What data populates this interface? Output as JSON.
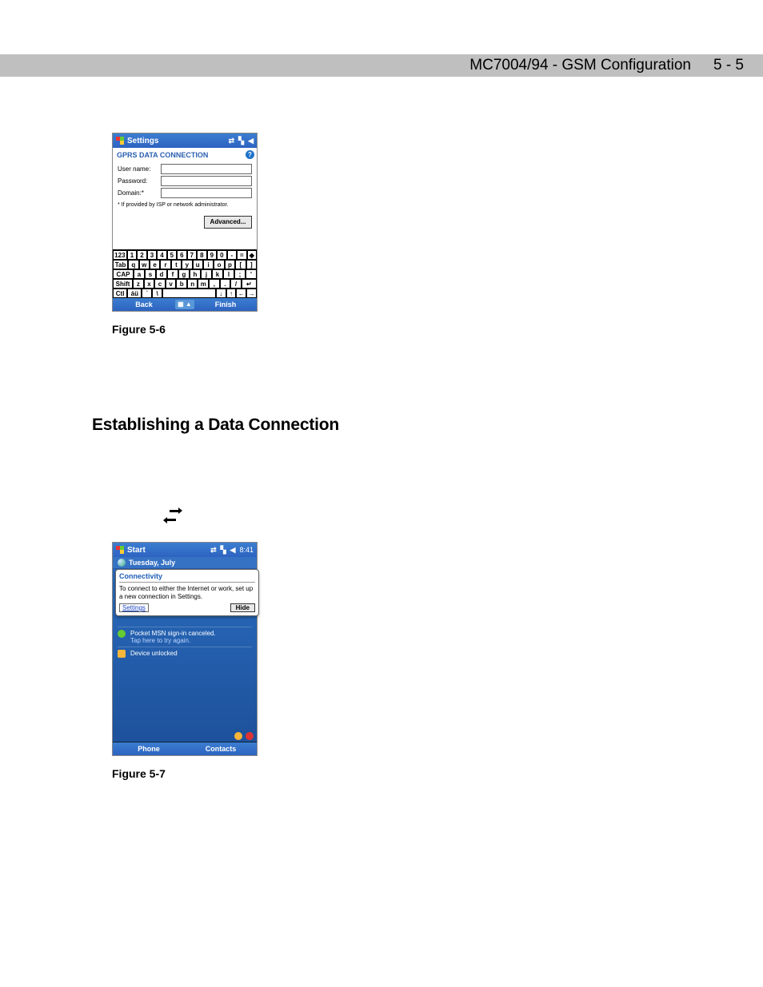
{
  "header": {
    "title": "MC7004/94 - GSM Configuration",
    "pageno": "5 - 5"
  },
  "figure56": {
    "caption": "Figure 5-6",
    "titlebar_label": "Settings",
    "subtitle": "GPRS DATA CONNECTION",
    "help_icon_label": "?",
    "fields": {
      "username_label": "User name:",
      "password_label": "Password:",
      "domain_label": "Domain:*"
    },
    "note": "* If provided by ISP or network administrator.",
    "advanced_btn": "Advanced...",
    "keyboard": {
      "row1": [
        "123",
        "1",
        "2",
        "3",
        "4",
        "5",
        "6",
        "7",
        "8",
        "9",
        "0",
        "-",
        "=",
        "◆"
      ],
      "row2": [
        "Tab",
        "q",
        "w",
        "e",
        "r",
        "t",
        "y",
        "u",
        "i",
        "o",
        "p",
        "[",
        "]"
      ],
      "row3": [
        "CAP",
        "a",
        "s",
        "d",
        "f",
        "g",
        "h",
        "j",
        "k",
        "l",
        ";",
        "'"
      ],
      "row4": [
        "Shift",
        "z",
        "x",
        "c",
        "v",
        "b",
        "n",
        "m",
        ",",
        ".",
        "/",
        "↵"
      ],
      "row5": [
        "Ctl",
        "áü",
        "`",
        "\\",
        " ",
        "↓",
        "↑",
        "←",
        "→"
      ]
    },
    "bottombar": {
      "back": "Back",
      "mid": "▦ ▲",
      "finish": "Finish"
    }
  },
  "section_heading": "Establishing a Data Connection",
  "figure57": {
    "caption": "Figure 5-7",
    "titlebar_label": "Start",
    "clock": "8:41",
    "date_row": "Tuesday, July",
    "bubble": {
      "title": "Connectivity",
      "text": "To connect to either the Internet or work, set up a new connection in Settings.",
      "link": "Settings",
      "hide": "Hide"
    },
    "items": {
      "msn_line1": "Pocket MSN sign-in canceled.",
      "msn_line2": "Tap here to try again.",
      "lock": "Device unlocked"
    },
    "bottombar": {
      "left": "Phone",
      "right": "Contacts"
    }
  }
}
